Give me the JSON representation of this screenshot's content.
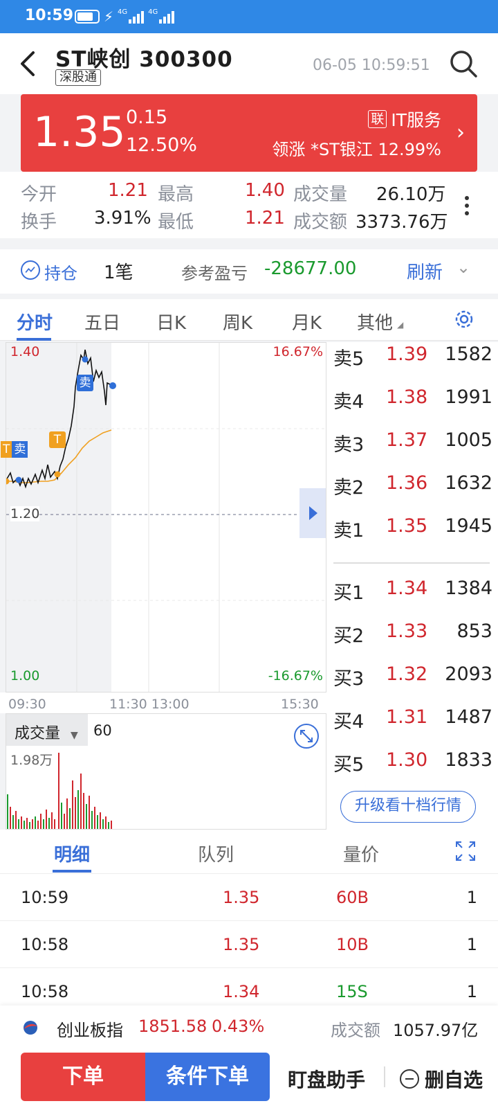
{
  "status": {
    "time": "10:59",
    "net1": "4G",
    "net2": "4G"
  },
  "header": {
    "title": "ST峡创 300300",
    "tag": "深股通",
    "datetime": "06-05 10:59:51"
  },
  "price": {
    "last": "1.35",
    "change": "0.15",
    "pct": "12.50%",
    "sector_badge": "联",
    "sector": "IT服务",
    "leader": "领涨 *ST银江 12.99%"
  },
  "quotes": {
    "open_label": "今开",
    "open": "1.21",
    "high_label": "最高",
    "high": "1.40",
    "vol_label": "成交量",
    "vol": "26.10万",
    "turn_label": "换手",
    "turn": "3.91%",
    "low_label": "最低",
    "low": "1.21",
    "amt_label": "成交额",
    "amt": "3373.76万"
  },
  "position": {
    "label": "持仓",
    "count": "1笔",
    "pnl_label": "参考盈亏",
    "pnl": "-28677.00",
    "refresh": "刷新"
  },
  "chart_tabs": [
    "分时",
    "五日",
    "日K",
    "周K",
    "月K",
    "其他"
  ],
  "chart": {
    "y_top": "1.40",
    "y_mid": "1.20",
    "y_bot": "1.00",
    "pct_top": "16.67%",
    "pct_bot": "-16.67%",
    "times": [
      "09:30",
      "11:30 13:00",
      "15:30"
    ],
    "sell_marker": "卖",
    "t_marker": "T",
    "tsell_marker_t": "T",
    "tsell_marker_s": "卖"
  },
  "volume": {
    "label": "成交量",
    "n": "60",
    "max": "1.98万"
  },
  "book": {
    "asks": [
      {
        "label": "卖5",
        "price": "1.39",
        "vol": "1582"
      },
      {
        "label": "卖4",
        "price": "1.38",
        "vol": "1991"
      },
      {
        "label": "卖3",
        "price": "1.37",
        "vol": "1005"
      },
      {
        "label": "卖2",
        "price": "1.36",
        "vol": "1632"
      },
      {
        "label": "卖1",
        "price": "1.35",
        "vol": "1945"
      }
    ],
    "bids": [
      {
        "label": "买1",
        "price": "1.34",
        "vol": "1384"
      },
      {
        "label": "买2",
        "price": "1.33",
        "vol": "853"
      },
      {
        "label": "买3",
        "price": "1.32",
        "vol": "2093"
      },
      {
        "label": "买4",
        "price": "1.31",
        "vol": "1487"
      },
      {
        "label": "买5",
        "price": "1.30",
        "vol": "1833"
      }
    ],
    "upgrade": "升级看十档行情"
  },
  "detail_tabs": [
    "明细",
    "队列",
    "量价"
  ],
  "trades": [
    {
      "time": "10:59",
      "price": "1.35",
      "size": "60B",
      "count": "1"
    },
    {
      "time": "10:58",
      "price": "1.35",
      "size": "10B",
      "count": "1"
    },
    {
      "time": "10:58",
      "price": "1.34",
      "size": "15S",
      "count": "1"
    }
  ],
  "index": {
    "name": "创业板指",
    "value": "1851.58",
    "pct": "0.43%",
    "amt_label": "成交额",
    "amt": "1057.97亿"
  },
  "actions": {
    "order": "下单",
    "cond_order": "条件下单",
    "assist": "盯盘助手",
    "remove": "删自选"
  },
  "colors": {
    "red": "#e8403f",
    "blue": "#3a6fd8",
    "green": "#1a9a2e",
    "statusbar": "#2f88e6"
  }
}
